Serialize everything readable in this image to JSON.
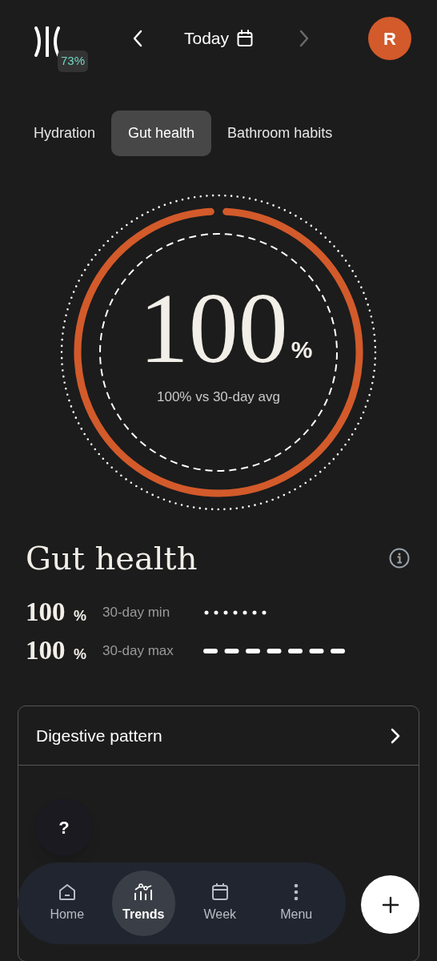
{
  "header": {
    "score_badge": "73%",
    "date_label": "Today",
    "next_disabled": true,
    "avatar_initial": "R"
  },
  "tabs": [
    {
      "label": "Hydration",
      "selected": false
    },
    {
      "label": "Gut health",
      "selected": true
    },
    {
      "label": "Bathroom habits",
      "selected": false
    }
  ],
  "gauge": {
    "value": "100",
    "unit": "%",
    "caption": "100% vs 30-day avg",
    "level": 1
  },
  "section": {
    "title": "Gut health"
  },
  "stats": [
    {
      "value": "100",
      "unit": "%",
      "label": "30-day min",
      "kind": "dotted"
    },
    {
      "value": "100",
      "unit": "%",
      "label": "30-day max",
      "kind": "dashed"
    }
  ],
  "card": {
    "title": "Digestive pattern"
  },
  "help_button": "?",
  "nav": [
    {
      "label": "Home",
      "kind": "home",
      "selected": false
    },
    {
      "label": "Trends",
      "kind": "trends",
      "selected": true
    },
    {
      "label": "Week",
      "kind": "week",
      "selected": false
    },
    {
      "label": "Menu",
      "kind": "menu",
      "selected": false
    }
  ]
}
